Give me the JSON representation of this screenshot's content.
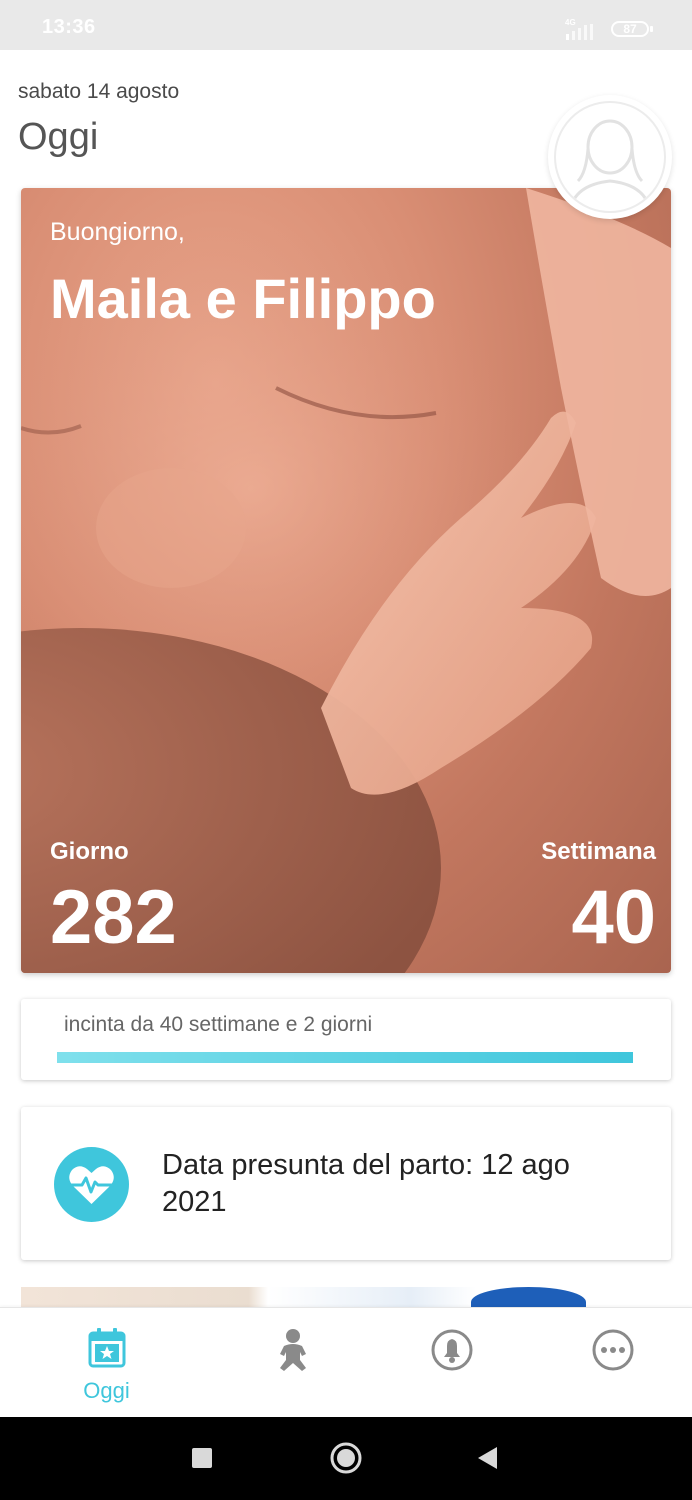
{
  "status_bar": {
    "time": "13:36",
    "network": "4G",
    "battery": "87"
  },
  "header": {
    "date": "sabato 14 agosto",
    "title": "Oggi",
    "avatar_icon": "profile-avatar-icon"
  },
  "hero": {
    "greeting": "Buongiorno,",
    "names": "Maila e Filippo",
    "day_label": "Giorno",
    "day_value": "282",
    "week_label": "Settimana",
    "week_value": "40"
  },
  "progress": {
    "text": "incinta da 40 settimane e 2 giorni",
    "fraction": 1.0,
    "color": "#3fc6dc"
  },
  "due_date": {
    "icon": "heart-pulse-icon",
    "text": "Data presunta del parto: 12 ago 2021"
  },
  "bottom_nav": {
    "items": [
      {
        "icon": "calendar-star-icon",
        "label": "Oggi",
        "active": true
      },
      {
        "icon": "baby-icon",
        "label": "",
        "active": false
      },
      {
        "icon": "notification-bell-icon",
        "label": "",
        "active": false
      },
      {
        "icon": "more-icon",
        "label": "",
        "active": false
      }
    ],
    "active_color": "#3fc6dc",
    "inactive_color": "#8a8a8a"
  },
  "system_nav": {
    "items": [
      "recents-button",
      "home-button",
      "back-button"
    ]
  }
}
